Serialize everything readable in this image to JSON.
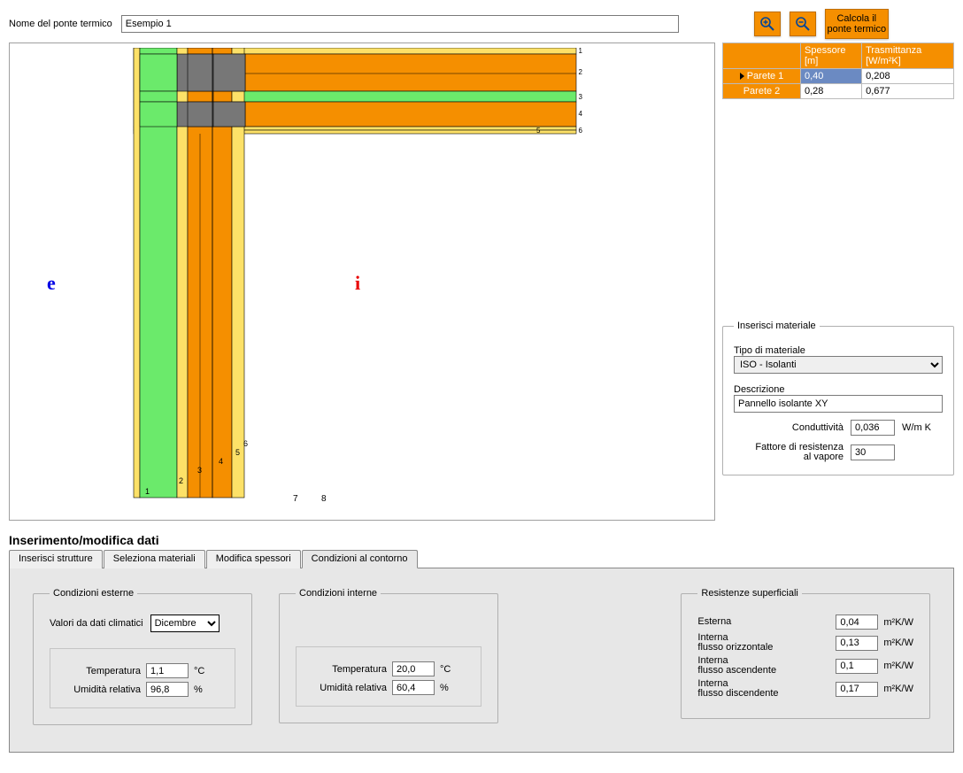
{
  "header": {
    "nome_label": "Nome del ponte termico",
    "nome_value": "Esempio 1",
    "calcola_label": "Calcola il ponte termico"
  },
  "walls_table": {
    "headers": {
      "blank": "",
      "spessore": "Spessore [m]",
      "trasmittanza": "Trasmittanza [W/m²K]"
    },
    "rows": [
      {
        "name": "Parete 1",
        "spessore": "0,40",
        "trasmittanza": "0,208",
        "selected": true
      },
      {
        "name": "Parete 2",
        "spessore": "0,28",
        "trasmittanza": "0,677",
        "selected": false
      }
    ]
  },
  "material_box": {
    "legend": "Inserisci materiale",
    "tipo_label": "Tipo di materiale",
    "tipo_value": "ISO - Isolanti",
    "descrizione_label": "Descrizione",
    "descrizione_value": "Pannello isolante XY",
    "conduttivita_label": "Conduttività",
    "conduttivita_value": "0,036",
    "conduttivita_unit": "W/m K",
    "fattore_label": "Fattore di resistenza al vapore",
    "fattore_value": "30"
  },
  "section": {
    "title": "Inserimento/modifica dati",
    "tabs": [
      "Inserisci strutture",
      "Seleziona materiali",
      "Modifica spessori",
      "Condizioni al contorno"
    ],
    "active_tab": 3
  },
  "external": {
    "legend": "Condizioni esterne",
    "climatici_label": "Valori da dati climatici",
    "month": "Dicembre",
    "temperatura_label": "Temperatura",
    "temperatura_value": "1,1",
    "temperatura_unit": "°C",
    "umidita_label": "Umidità relativa",
    "umidita_value": "96,8",
    "umidita_unit": "%"
  },
  "internal": {
    "legend": "Condizioni interne",
    "temperatura_label": "Temperatura",
    "temperatura_value": "20,0",
    "temperatura_unit": "°C",
    "umidita_label": "Umidità relativa",
    "umidita_value": "60,4",
    "umidita_unit": "%"
  },
  "resistances": {
    "legend": "Resistenze superficiali",
    "unit": "m²K/W",
    "rows": [
      {
        "label": "Esterna",
        "value": "0,04"
      },
      {
        "label": "Interna\nflusso orizzontale",
        "value": "0,13"
      },
      {
        "label": "Interna\nflusso ascendente",
        "value": "0,1"
      },
      {
        "label": "Interna\nflusso discendente",
        "value": "0,17"
      }
    ]
  },
  "diagram": {
    "bottom_labels": [
      "1",
      "2",
      "3",
      "4",
      "5",
      "6",
      "7",
      "8"
    ],
    "right_labels": [
      "1",
      "2",
      "3",
      "4",
      "5",
      "6"
    ],
    "e_label": "e",
    "i_label": "i"
  }
}
